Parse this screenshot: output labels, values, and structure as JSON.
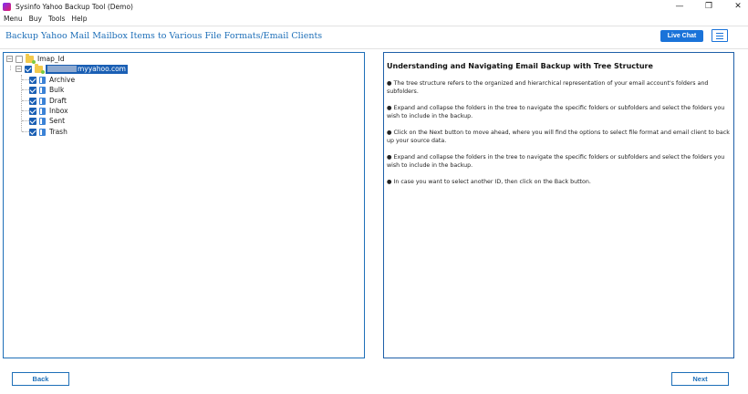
{
  "window": {
    "title": "Sysinfo Yahoo Backup Tool (Demo)",
    "minimize_glyph": "—",
    "restore_glyph": "❐",
    "close_glyph": "✕"
  },
  "menu": {
    "items": [
      "Menu",
      "Buy",
      "Tools",
      "Help"
    ]
  },
  "header": {
    "heading": "Backup Yahoo Mail Mailbox Items to Various File Formats/Email Clients",
    "live_chat_label": "Live Chat"
  },
  "tree": {
    "root": {
      "label": "Imap_Id",
      "checked": false,
      "expander": "−"
    },
    "account": {
      "label": "myyahoo.com",
      "checked": true,
      "expander": "−"
    },
    "folders": [
      {
        "label": "Archive",
        "checked": true
      },
      {
        "label": "Bulk",
        "checked": true
      },
      {
        "label": "Draft",
        "checked": true
      },
      {
        "label": "Inbox",
        "checked": true
      },
      {
        "label": "Sent",
        "checked": true
      },
      {
        "label": "Trash",
        "checked": true
      }
    ]
  },
  "info": {
    "title": "Understanding and Navigating Email Backup with Tree Structure",
    "paragraphs": [
      "● The tree structure refers to the organized and hierarchical representation of your email account's folders and subfolders.",
      "● Expand and collapse the folders in the tree to navigate the specific folders or subfolders and select the folders you wish to include in the backup.",
      "● Click on the Next button to move ahead, where you will find the options to select file format and email client to back up your source data.",
      "● Expand and collapse the folders in the tree to navigate the specific folders or subfolders and select the folders you wish to include in the backup.",
      "● In case you want to select another ID, then click on the Back button."
    ]
  },
  "footer": {
    "back_label": "Back",
    "next_label": "Next"
  },
  "colors": {
    "accent": "#1e6fb8",
    "live_chat_bg": "#1a73d9",
    "selection": "#1a5fb4"
  }
}
